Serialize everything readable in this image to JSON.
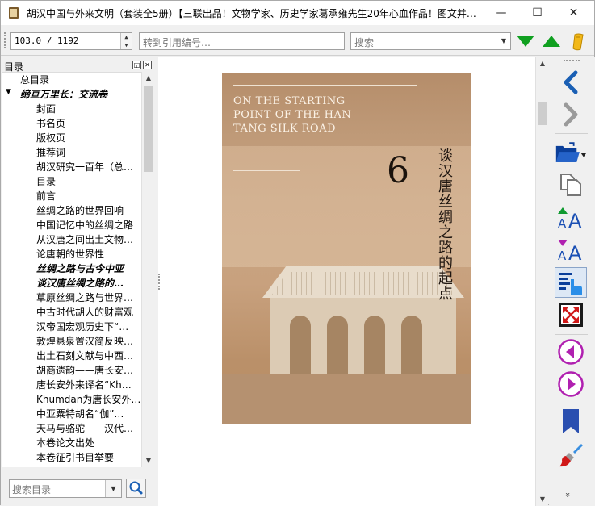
{
  "window": {
    "title": "胡汉中国与外来文明（套装全5册）【三联出品！文物学家、历史学家葛承雍先生20年心血作品！图文并…",
    "minimize_glyph": "—",
    "maximize_glyph": "☐",
    "close_glyph": "✕"
  },
  "toolbar": {
    "page_value": "103.0 / 1192",
    "goto_placeholder": "转到引用编号…",
    "search_placeholder": "搜索",
    "accent_green": "#10a020",
    "bookmark_color": "#f2b818"
  },
  "toc": {
    "header": "目录",
    "search_placeholder": "搜索目录",
    "items": [
      {
        "label": "总目录",
        "level": 1,
        "bold": false,
        "expander": ""
      },
      {
        "label": "缔亘万里长：交流卷",
        "level": 1,
        "bold": true,
        "expander": "▼"
      },
      {
        "label": "封面",
        "level": 2,
        "bold": false,
        "expander": ""
      },
      {
        "label": "书名页",
        "level": 2,
        "bold": false,
        "expander": ""
      },
      {
        "label": "版权页",
        "level": 2,
        "bold": false,
        "expander": ""
      },
      {
        "label": "推荐词",
        "level": 2,
        "bold": false,
        "expander": ""
      },
      {
        "label": "胡汉研究一百年（总…",
        "level": 2,
        "bold": false,
        "expander": ""
      },
      {
        "label": "目录",
        "level": 2,
        "bold": false,
        "expander": ""
      },
      {
        "label": "前言",
        "level": 2,
        "bold": false,
        "expander": ""
      },
      {
        "label": "丝绸之路的世界回响",
        "level": 2,
        "bold": false,
        "expander": ""
      },
      {
        "label": "中国记忆中的丝绸之路",
        "level": 2,
        "bold": false,
        "expander": ""
      },
      {
        "label": "从汉唐之间出土文物…",
        "level": 2,
        "bold": false,
        "expander": ""
      },
      {
        "label": "论唐朝的世界性",
        "level": 2,
        "bold": false,
        "expander": ""
      },
      {
        "label": "丝绸之路与古今中亚",
        "level": 2,
        "bold": true,
        "expander": ""
      },
      {
        "label": "谈汉唐丝绸之路的…",
        "level": 2,
        "bold": true,
        "expander": ""
      },
      {
        "label": "草原丝绸之路与世界…",
        "level": 2,
        "bold": false,
        "expander": ""
      },
      {
        "label": "中古时代胡人的财富观",
        "level": 2,
        "bold": false,
        "expander": ""
      },
      {
        "label": "汉帝国宏观历史下“…",
        "level": 2,
        "bold": false,
        "expander": ""
      },
      {
        "label": "敦煌悬泉置汉简反映…",
        "level": 2,
        "bold": false,
        "expander": ""
      },
      {
        "label": "出土石刻文献与中西…",
        "level": 2,
        "bold": false,
        "expander": ""
      },
      {
        "label": "胡商遗韵——唐长安…",
        "level": 2,
        "bold": false,
        "expander": ""
      },
      {
        "label": "唐长安外来译名“Kh…",
        "level": 2,
        "bold": false,
        "expander": ""
      },
      {
        "label": "Khumdan为唐长安外…",
        "level": 2,
        "bold": false,
        "expander": ""
      },
      {
        "label": "中亚粟特胡名“伽”…",
        "level": 2,
        "bold": false,
        "expander": ""
      },
      {
        "label": "天马与骆驼——汉代…",
        "level": 2,
        "bold": false,
        "expander": ""
      },
      {
        "label": "本卷论文出处",
        "level": 2,
        "bold": false,
        "expander": ""
      },
      {
        "label": "本卷征引书目举要",
        "level": 2,
        "bold": false,
        "expander": ""
      }
    ]
  },
  "page": {
    "english_title": "ON THE STARTING POINT OF THE HAN-TANG SILK ROAD",
    "chapter_number": "6",
    "chinese_title": "谈汉唐丝绸之路的起点",
    "cover_color": "#c39c79"
  },
  "sidebar": {
    "icons": [
      "back-chevron-icon",
      "forward-chevron-icon",
      "open-folder-icon",
      "copy-pages-icon",
      "font-increase-icon",
      "font-decrease-icon",
      "toc-pointer-icon",
      "fullscreen-icon",
      "previous-page-icon",
      "next-page-icon",
      "bookmark-ribbon-icon",
      "brush-icon"
    ],
    "more_glyph": "»"
  }
}
